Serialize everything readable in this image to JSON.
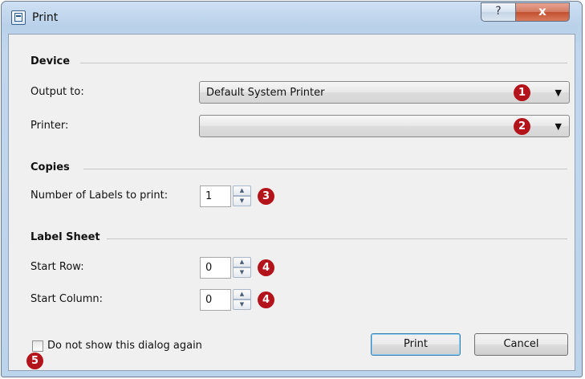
{
  "window": {
    "title": "Print",
    "help_glyph": "?",
    "close_glyph": "x"
  },
  "device": {
    "section_label": "Device",
    "output_to": {
      "label": "Output to:",
      "value": "Default System Printer",
      "badge": "1"
    },
    "printer": {
      "label": "Printer:",
      "value": "",
      "badge": "2"
    }
  },
  "copies": {
    "section_label": "Copies",
    "labels_to_print": {
      "label": "Number of Labels to print:",
      "value": "1",
      "badge": "3"
    }
  },
  "label_sheet": {
    "section_label": "Label Sheet",
    "start_row": {
      "label": "Start Row:",
      "value": "0",
      "badge": "4"
    },
    "start_column": {
      "label": "Start Column:",
      "value": "0",
      "badge": "4"
    }
  },
  "footer": {
    "checkbox_label": "Do not show this dialog again",
    "checkbox_checked": false,
    "checkbox_badge": "5",
    "print_button": "Print",
    "cancel_button": "Cancel"
  },
  "icons": {
    "dropdown": "▼",
    "spin_up": "▲",
    "spin_down": "▼"
  },
  "colors": {
    "badge": "#b3141b",
    "title_bar": "#b9d1ea",
    "close_button": "#c4502f"
  }
}
